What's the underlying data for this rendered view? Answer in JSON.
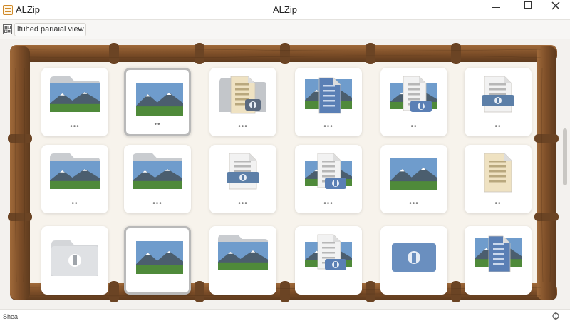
{
  "window": {
    "app_name": "ALZip",
    "title": "ALZip"
  },
  "toolbar": {
    "view_mode_label": "ltuhed pariaial view"
  },
  "status": {
    "text": "Shea"
  },
  "grid": {
    "rows": 3,
    "columns": 6,
    "tiles": [
      {
        "type": "image-folder",
        "dots": "•••",
        "selected": false
      },
      {
        "type": "image",
        "dots": "••",
        "selected": true
      },
      {
        "type": "document-folder",
        "dots": "•••",
        "selected": false
      },
      {
        "type": "document-image",
        "dots": "•••",
        "selected": false
      },
      {
        "type": "document-image-archive",
        "dots": "••",
        "selected": false
      },
      {
        "type": "document-archive",
        "dots": "••",
        "selected": false
      },
      {
        "type": "image-folder",
        "dots": "••",
        "selected": false
      },
      {
        "type": "image-folder",
        "dots": "•••",
        "selected": false
      },
      {
        "type": "document-archive",
        "dots": "•••",
        "selected": false
      },
      {
        "type": "document-image-archive",
        "dots": "•••",
        "selected": false
      },
      {
        "type": "image",
        "dots": "•••",
        "selected": false
      },
      {
        "type": "document",
        "dots": "••",
        "selected": false
      },
      {
        "type": "archive-folder",
        "dots": "",
        "selected": false
      },
      {
        "type": "image",
        "dots": "",
        "selected": true
      },
      {
        "type": "image-folder",
        "dots": "",
        "selected": false
      },
      {
        "type": "document-image-archive",
        "dots": "",
        "selected": false
      },
      {
        "type": "archive-folder-blue",
        "dots": "",
        "selected": false
      },
      {
        "type": "document-image",
        "dots": "",
        "selected": false
      }
    ]
  },
  "colors": {
    "wood": "#8a5a32",
    "wood_dark": "#5e3b1e",
    "background": "#f3f1ee",
    "doc_blue": "#5a7fb5",
    "doc_beige": "#efe2c2"
  }
}
